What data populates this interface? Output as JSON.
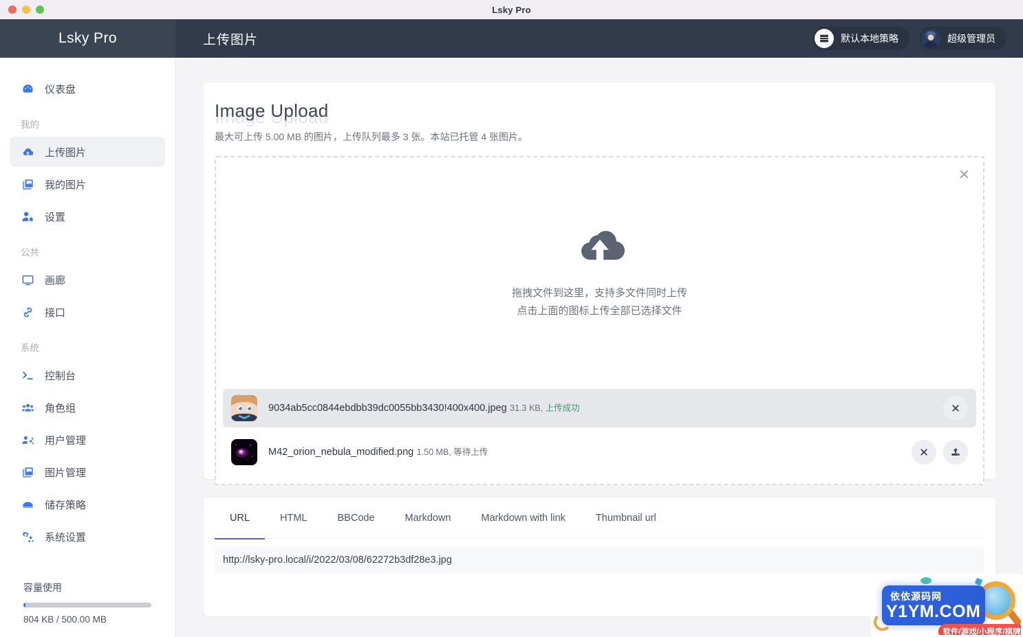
{
  "window": {
    "title": "Lsky Pro",
    "traffic_lights": [
      "close",
      "minimize",
      "maximize"
    ]
  },
  "brand": {
    "name": "Lsky Pro"
  },
  "topbar": {
    "page_title": "上传图片",
    "strategy_pill": {
      "label": "默认本地策略",
      "icon": "server-icon"
    },
    "user_pill": {
      "label": "超级管理员",
      "icon": "avatar"
    }
  },
  "sidebar": {
    "items": [
      {
        "label": "仪表盘",
        "icon": "dashboard-icon",
        "type": "item",
        "active": false
      },
      {
        "label": "我的",
        "type": "group"
      },
      {
        "label": "上传图片",
        "icon": "cloud-upload-icon",
        "type": "item",
        "active": true
      },
      {
        "label": "我的图片",
        "icon": "photo-icon",
        "type": "item",
        "active": false
      },
      {
        "label": "设置",
        "icon": "user-cog-icon",
        "type": "item",
        "active": false
      },
      {
        "label": "公共",
        "type": "group"
      },
      {
        "label": "画廊",
        "icon": "gallery-icon",
        "type": "item",
        "active": false
      },
      {
        "label": "接口",
        "icon": "link-icon",
        "type": "item",
        "active": false
      },
      {
        "label": "系统",
        "type": "group"
      },
      {
        "label": "控制台",
        "icon": "terminal-icon",
        "type": "item",
        "active": false
      },
      {
        "label": "角色组",
        "icon": "users-icon",
        "type": "item",
        "active": false
      },
      {
        "label": "用户管理",
        "icon": "user-manage-icon",
        "type": "item",
        "active": false
      },
      {
        "label": "图片管理",
        "icon": "photo-icon",
        "type": "item",
        "active": false
      },
      {
        "label": "储存策略",
        "icon": "storage-icon",
        "type": "item",
        "active": false
      },
      {
        "label": "系统设置",
        "icon": "cogs-icon",
        "type": "item",
        "active": false
      }
    ],
    "capacity": {
      "title": "容量使用",
      "used_label": "804 KB / 500.00 MB",
      "percent": 1.5
    }
  },
  "upload_card": {
    "title": "Image Upload",
    "description": "最大可上传 5.00 MB 的图片，上传队列最多 3 张。本站已托管 4 张图片。",
    "close_icon": "close-icon",
    "dropzone": {
      "icon": "cloud-upload-icon",
      "line1": "拖拽文件到这里，支持多文件同时上传",
      "line2": "点击上面的图标上传全部已选择文件"
    },
    "files": [
      {
        "name": "9034ab5cc0844ebdbb39dc0055bb3430!400x400.jpeg",
        "size": "31.3 KB",
        "status": "上传成功",
        "status_type": "success",
        "separator": ", ",
        "thumb": "anime-avatar",
        "actions": [
          "remove"
        ]
      },
      {
        "name": "M42_orion_nebula_modified.png",
        "size": "1.50 MB",
        "status": "等待上传",
        "status_type": "pending",
        "separator": ", ",
        "thumb": "nebula",
        "actions": [
          "remove",
          "upload"
        ]
      }
    ]
  },
  "links_card": {
    "tabs": [
      {
        "label": "URL",
        "active": true
      },
      {
        "label": "HTML",
        "active": false
      },
      {
        "label": "BBCode",
        "active": false
      },
      {
        "label": "Markdown",
        "active": false
      },
      {
        "label": "Markdown with link",
        "active": false
      },
      {
        "label": "Thumbnail url",
        "active": false
      }
    ],
    "url_value": "http://lsky-pro.local/i/2022/03/08/62272b3df28e3.jpg"
  },
  "watermark": {
    "line1": "依依源码网",
    "line2": "Y1YM.COM",
    "line3": "软件/游戏/小程序/棋牌"
  },
  "colors": {
    "brand_bar": "#3b4453",
    "topbar": "#323b4c",
    "accent_blue": "#3b77f0",
    "tab_active": "#5b5ce2",
    "success_green": "#3f9a6d"
  }
}
